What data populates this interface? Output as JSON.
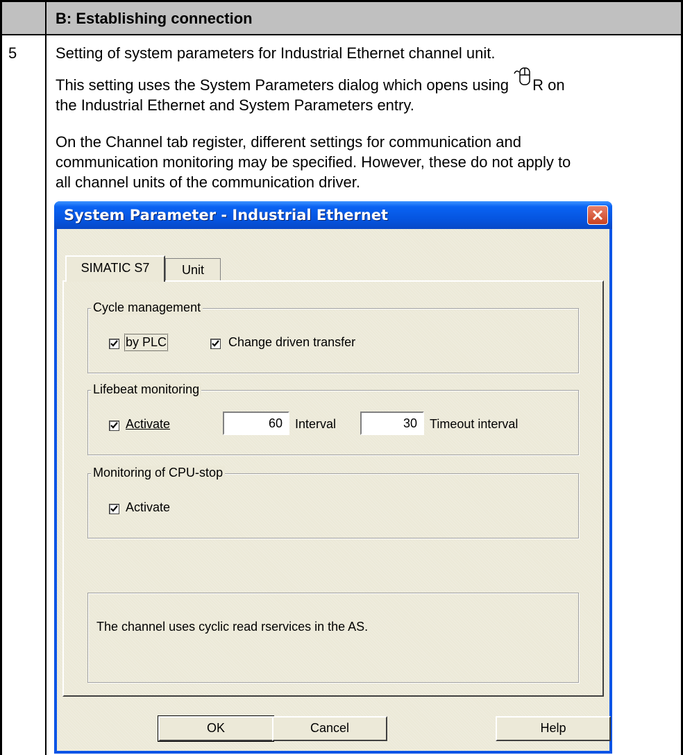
{
  "document": {
    "header_title": "B: Establishing connection",
    "step_number": "5",
    "paragraph1": "Setting of system parameters for Industrial Ethernet channel unit.",
    "paragraph2_part1": "This setting uses the System Parameters dialog which opens using ",
    "paragraph2_part2": "R on",
    "paragraph2_line2": "the Industrial Ethernet and System Parameters entry.",
    "paragraph3_line1": "On the Channel tab register, different settings for communication and",
    "paragraph3_line2": "communication monitoring may be specified. However, these do not apply to",
    "paragraph3_line3": "all channel units of the communication driver.",
    "mouse_icon": "mouse-click-icon"
  },
  "dialog": {
    "title": "System Parameter - Industrial Ethernet",
    "tabs": [
      {
        "label": "SIMATIC S7",
        "active": true
      },
      {
        "label": "Unit",
        "active": false
      }
    ],
    "cycle_management": {
      "label": "Cycle management",
      "by_plc": {
        "label": "by PLC",
        "checked": true
      },
      "change_driven": {
        "label": "Change driven transfer",
        "checked": true
      }
    },
    "lifebeat": {
      "label": "Lifebeat monitoring",
      "activate": {
        "label": "Activate",
        "checked": true
      },
      "interval_value": "60",
      "interval_label": "Interval",
      "timeout_value": "30",
      "timeout_label": "Timeout interval"
    },
    "cpu_stop": {
      "label": "Monitoring of CPU-stop",
      "activate": {
        "label": "Activate",
        "checked": true
      }
    },
    "info_text": "The channel uses cyclic read rservices in the AS.",
    "buttons": {
      "ok": "OK",
      "cancel": "Cancel",
      "help": "Help"
    },
    "colors": {
      "titlebar": "#0a54e6",
      "face": "#ece9d8",
      "close": "#c94220",
      "header_gray": "#c0c0c0"
    }
  }
}
